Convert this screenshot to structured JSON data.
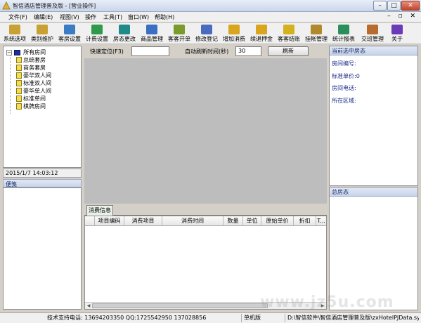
{
  "window": {
    "title": "智信酒店管理普及版 - [营业操作]",
    "controls": {
      "minimize": "–",
      "maximize": "□",
      "close": "✕"
    }
  },
  "menu": {
    "items": [
      "文件(F)",
      "编辑(E)",
      "视图(V)",
      "操作",
      "工具(T)",
      "窗口(W)",
      "帮助(H)"
    ],
    "mdi_controls": "– ▫ ✕"
  },
  "toolbar": {
    "tools": [
      {
        "label": "系统选项",
        "icon": "system-options-icon",
        "color": "#c9a132"
      },
      {
        "label": "类别维护",
        "icon": "category-icon",
        "color": "#c9a132"
      },
      {
        "label": "客房设置",
        "icon": "room-setting-icon",
        "color": "#3b7dc4"
      },
      {
        "label": "计费设置",
        "icon": "billing-setting-icon",
        "color": "#2f9a4a"
      },
      {
        "label": "房态更改",
        "icon": "room-status-icon",
        "color": "#1e8a8a"
      },
      {
        "label": "商品管理",
        "icon": "goods-icon",
        "color": "#3b6fc4"
      },
      {
        "label": "客客开单",
        "icon": "open-bill-icon",
        "color": "#7a9a2a"
      },
      {
        "label": "修改登记",
        "icon": "edit-register-icon",
        "color": "#4a6cc0"
      },
      {
        "label": "增加消费",
        "icon": "add-consume-icon",
        "color": "#d9a51e"
      },
      {
        "label": "续退押金",
        "icon": "deposit-icon",
        "color": "#d9a51e"
      },
      {
        "label": "客客结账",
        "icon": "checkout-icon",
        "color": "#d4b21e"
      },
      {
        "label": "挂帐管理",
        "icon": "credit-icon",
        "color": "#b08a2a"
      },
      {
        "label": "统计报表",
        "icon": "report-icon",
        "color": "#2a8f5a"
      },
      {
        "label": "交班管理",
        "icon": "shift-icon",
        "color": "#b86b2e"
      },
      {
        "label": "关于",
        "icon": "about-icon",
        "color": "#6a3ab8"
      }
    ]
  },
  "tree": {
    "root": "所有房间",
    "items": [
      "总统套房",
      "商务套房",
      "豪华双人间",
      "标准双人间",
      "豪华单人间",
      "标准单间",
      "棋牌房间"
    ]
  },
  "datetime": "2015/1/7  14:03:12",
  "memo": {
    "title": "便笺"
  },
  "quick": {
    "locate_label": "快速定位(F3)",
    "locate_value": "",
    "refresh_label": "自动刷新时间(秒)",
    "refresh_value": "30",
    "refresh_button": "刷新"
  },
  "tabs": {
    "consumption": "消费信息"
  },
  "grid": {
    "columns": [
      "项目编码",
      "消费项目",
      "消费时间",
      "数量",
      "单位",
      "原始单价",
      "折扣",
      "T..."
    ],
    "rows": []
  },
  "right": {
    "title": "当前选中房态",
    "fields": [
      "房间编号:",
      "标准单价:0",
      "房间电话:",
      "所在区域:"
    ],
    "summary_title": "总房态"
  },
  "status": {
    "support": "技术支持电话: 13694203350 QQ:1725542950 137028856",
    "edition": "单机版",
    "path": "D:\\智信软件\\智信酒店管理普及版\\zxHotelPJData.sy"
  },
  "watermark": "www.jz5u.com"
}
